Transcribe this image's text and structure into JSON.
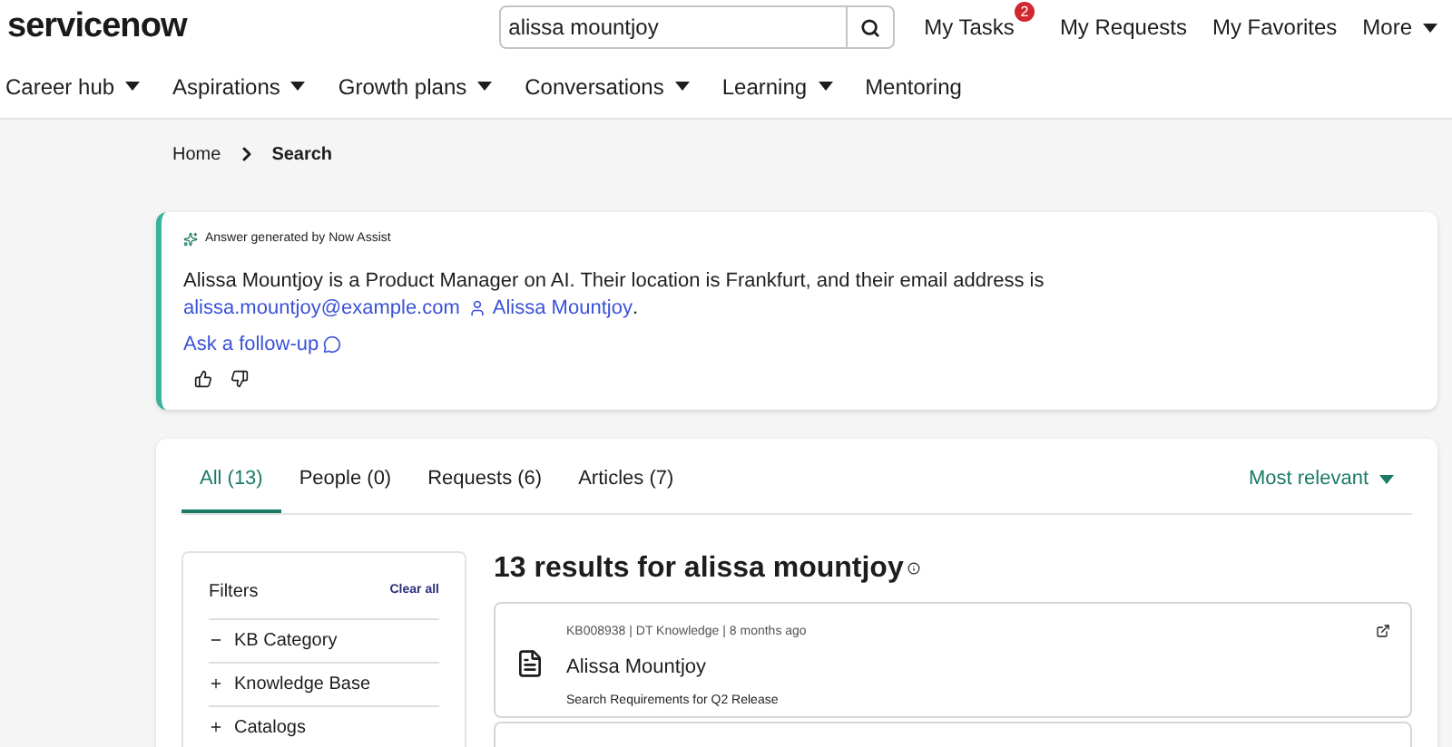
{
  "header": {
    "logo": "servicenow",
    "search": {
      "value": "alissa mountjoy"
    },
    "links": [
      {
        "label": "My Tasks",
        "badge": "2",
        "dropdown": false
      },
      {
        "label": "My Requests",
        "dropdown": false
      },
      {
        "label": "My Favorites",
        "dropdown": false
      },
      {
        "label": "More",
        "dropdown": true
      }
    ]
  },
  "nav": [
    {
      "label": "Career hub",
      "dropdown": true
    },
    {
      "label": "Aspirations",
      "dropdown": true
    },
    {
      "label": "Growth plans",
      "dropdown": true
    },
    {
      "label": "Conversations",
      "dropdown": true
    },
    {
      "label": "Learning",
      "dropdown": true
    },
    {
      "label": "Mentoring",
      "dropdown": false
    }
  ],
  "breadcrumb": [
    "Home",
    "Search"
  ],
  "answer": {
    "source": "Answer generated by Now Assist",
    "text": "Alissa Mountjoy is a Product Manager on AI. Their location is Frankfurt, and their email address is",
    "email": "alissa.mountjoy@example.com",
    "person": "Alissa Mountjoy",
    "end": ".",
    "followup": "Ask a follow-up"
  },
  "tabs": [
    {
      "label": "All (13)",
      "selected": true
    },
    {
      "label": "People (0)",
      "selected": false
    },
    {
      "label": "Requests (6)",
      "selected": false
    },
    {
      "label": "Articles (7)",
      "selected": false
    }
  ],
  "sort": "Most relevant",
  "filters": {
    "title": "Filters",
    "clear": "Clear all",
    "items": [
      {
        "label": "KB Category",
        "expanded": true
      },
      {
        "label": "Knowledge Base",
        "expanded": false
      },
      {
        "label": "Catalogs",
        "expanded": false
      }
    ]
  },
  "results_heading": "13 results for alissa mountjoy",
  "results": [
    {
      "meta": "KB008938 | DT Knowledge | 8 months ago",
      "title": "Alissa Mountjoy",
      "subtitle": "Search Requirements for Q2 Release"
    }
  ]
}
